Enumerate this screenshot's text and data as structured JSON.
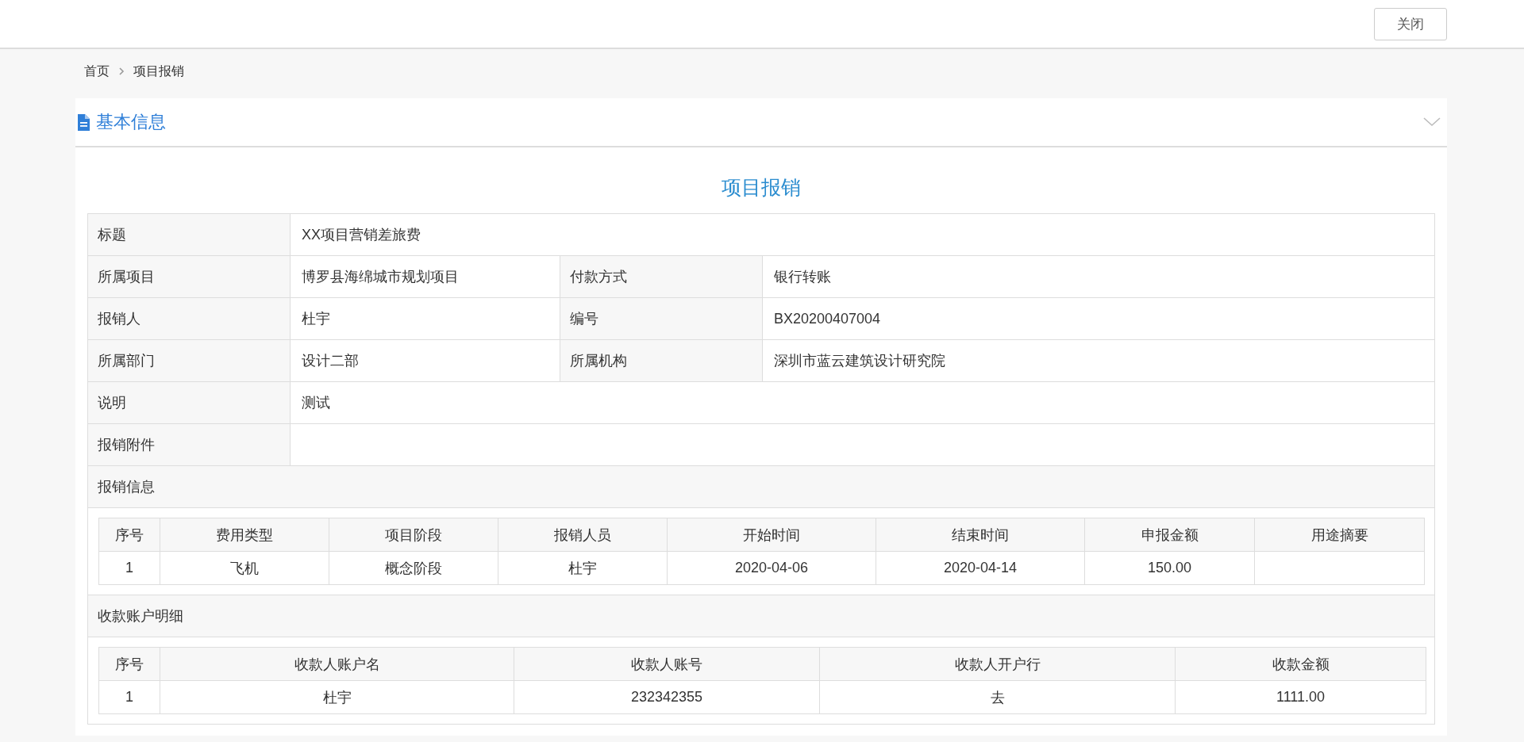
{
  "top_bar": {
    "close_button": "关闭"
  },
  "breadcrumb": [
    "首页",
    "项目报销"
  ],
  "panel": {
    "title": "基本信息",
    "expanded": true
  },
  "form": {
    "title": "项目报销",
    "rows": [
      [
        {
          "label": "标题",
          "value": "XX项目营销差旅费"
        }
      ],
      [
        {
          "label": "所属项目",
          "value": "博罗县海绵城市规划项目"
        },
        {
          "label": "付款方式",
          "value": "银行转账"
        }
      ],
      [
        {
          "label": "报销人",
          "value": "杜宇"
        },
        {
          "label": "编号",
          "value": "BX20200407004"
        }
      ],
      [
        {
          "label": "所属部门",
          "value": "设计二部"
        },
        {
          "label": "所属机构",
          "value": "深圳市蓝云建筑设计研究院"
        }
      ],
      [
        {
          "label": "说明",
          "value": "测试"
        }
      ],
      [
        {
          "label": "报销附件"
        }
      ]
    ]
  },
  "sections": [
    {
      "title": "报销信息",
      "columns": [
        "序号",
        "费用类型",
        "项目阶段",
        "报销人员",
        "开始时间",
        "结束时间",
        "申报金额",
        "用途摘要"
      ],
      "rows": [
        [
          "1",
          "飞机",
          "概念阶段",
          "杜宇",
          "2020-04-06",
          "2020-04-14",
          "150.00",
          null
        ]
      ]
    },
    {
      "title": "收款账户明细",
      "columns": [
        "序号",
        "收款人账户名",
        "收款人账号",
        "收款人开户行",
        "收款金额"
      ],
      "rows": [
        [
          "1",
          "杜宇",
          "232342355",
          "去",
          "1111.00"
        ]
      ]
    }
  ]
}
